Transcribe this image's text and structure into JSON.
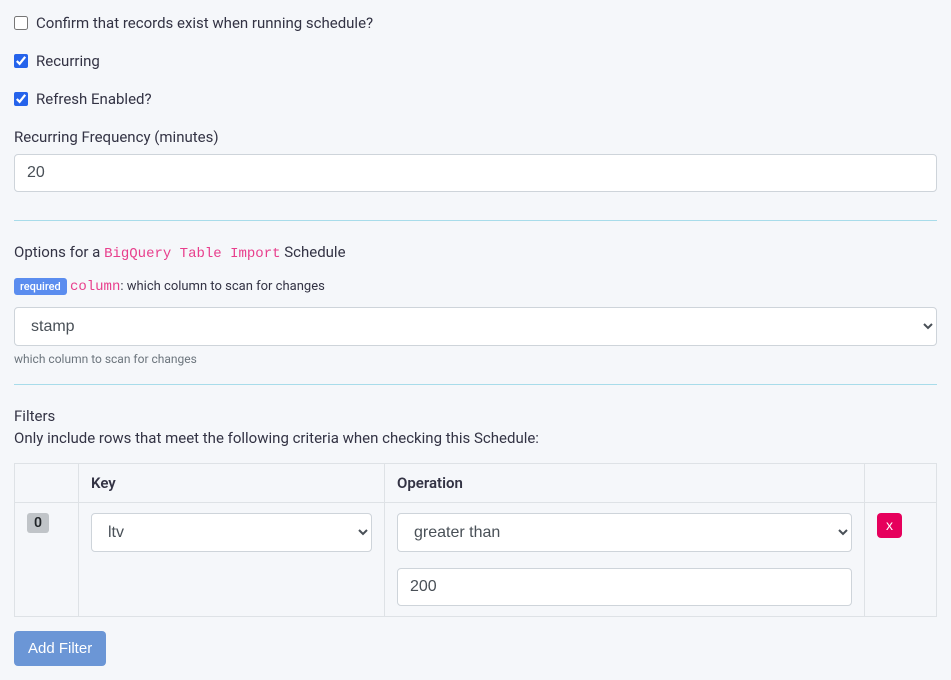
{
  "checkboxes": {
    "confirm_records": {
      "label": "Confirm that records exist when running schedule?",
      "checked": false
    },
    "recurring": {
      "label": "Recurring",
      "checked": true
    },
    "refresh_enabled": {
      "label": "Refresh Enabled?",
      "checked": true
    }
  },
  "recurring_frequency": {
    "label": "Recurring Frequency (minutes)",
    "value": "20"
  },
  "options_section": {
    "prefix": "Options for a ",
    "schedule_type": "BigQuery Table Import",
    "suffix": " Schedule"
  },
  "column_field": {
    "required_badge": "required",
    "code_label": "column",
    "description": ": which column to scan for changes",
    "selected": "stamp",
    "help": "which column to scan for changes"
  },
  "filters": {
    "heading": "Filters",
    "description": "Only include rows that meet the following criteria when checking this Schedule:",
    "headers": {
      "key": "Key",
      "operation": "Operation"
    },
    "rows": [
      {
        "index": "0",
        "key": "ltv",
        "operation": "greater than",
        "value": "200"
      }
    ],
    "delete_label": "x",
    "add_filter_label": "Add Filter"
  }
}
